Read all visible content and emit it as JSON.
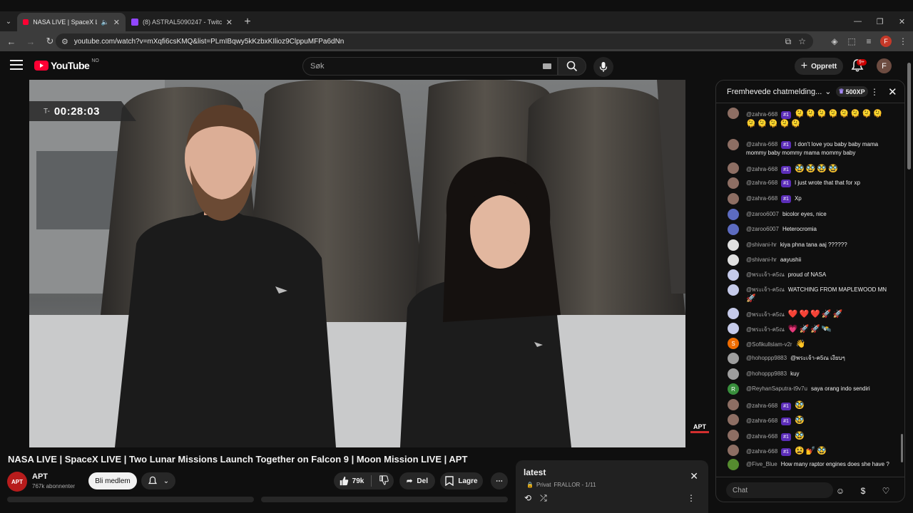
{
  "browser": {
    "tabs": [
      {
        "title": "NASA LIVE | SpaceX LIVE | T",
        "active": true
      },
      {
        "title": "(8) ASTRAL5090247 - Twitch",
        "active": false
      }
    ],
    "url": "youtube.com/watch?v=mXqfi6csKMQ&list=PLmIBqwy5kKzbxKIlioz9ClppuMFPa6dNn",
    "profile_initial": "F"
  },
  "header": {
    "logo_text": "YouTube",
    "country_code": "NO",
    "search_placeholder": "Søk",
    "create_label": "Opprett",
    "notification_count": "9+",
    "avatar_initial": "F"
  },
  "video": {
    "timer_prefix": "T-",
    "timer_value": "00:28:03",
    "watermark": "APT",
    "title": "NASA LIVE | SpaceX LIVE | Two Lunar Missions Launch Together on Falcon 9 | Moon Mission LIVE | APT"
  },
  "channel": {
    "avatar_text": "APT",
    "name": "APT",
    "subscribers": "767k abonnenter",
    "join_label": "Bli medlem"
  },
  "actions": {
    "likes": "79k",
    "share_label": "Del",
    "save_label": "Lagre"
  },
  "playlist": {
    "title": "latest",
    "privacy": "Privat",
    "owner_progress": "FRALLOR - 1/11"
  },
  "chat": {
    "title": "Fremhevede chatmelding...",
    "xp": "500XP",
    "input_placeholder": "Chat",
    "messages": [
      {
        "author": "@zahra-668",
        "badge": "#1",
        "text": "",
        "emoji": "🫠🫠🫠🫠🫠🫠🫠🫠🫠🫠🫠🫠🫠",
        "avatar_color": "#8d6e63",
        "avatar_text": ""
      },
      {
        "author": "@zahra-668",
        "badge": "#1",
        "text": "I don't love you baby baby mama mommy baby mommy mama mommy baby",
        "emoji": "",
        "avatar_color": "#8d6e63",
        "avatar_text": ""
      },
      {
        "author": "@zahra-668",
        "badge": "#1",
        "text": "",
        "emoji": "🥸🥸🥸🥸",
        "avatar_color": "#8d6e63",
        "avatar_text": ""
      },
      {
        "author": "@zahra-668",
        "badge": "#1",
        "text": "I just wrote that that for xp",
        "emoji": "",
        "avatar_color": "#8d6e63",
        "avatar_text": ""
      },
      {
        "author": "@zahra-668",
        "badge": "#1",
        "text": "Xp",
        "emoji": "",
        "avatar_color": "#8d6e63",
        "avatar_text": ""
      },
      {
        "author": "@zaroo6007",
        "badge": "",
        "text": "bicolor eyes, nice",
        "emoji": "",
        "avatar_color": "#5c6bc0",
        "avatar_text": ""
      },
      {
        "author": "@zaroo6007",
        "badge": "",
        "text": "Heterocromia",
        "emoji": "",
        "avatar_color": "#5c6bc0",
        "avatar_text": ""
      },
      {
        "author": "@shivani-hr",
        "badge": "",
        "text": "kiya phna tana aaj ??????",
        "emoji": "",
        "avatar_color": "#e0e0e0",
        "avatar_text": ""
      },
      {
        "author": "@shivani-hr",
        "badge": "",
        "text": "aayushii",
        "emoji": "",
        "avatar_color": "#e0e0e0",
        "avatar_text": ""
      },
      {
        "author": "@พระเจ้า-ค5ณ",
        "badge": "",
        "text": "proud of NASA",
        "emoji": "",
        "avatar_color": "#c5cae9",
        "avatar_text": ""
      },
      {
        "author": "@พระเจ้า-ค5ณ",
        "badge": "",
        "text": "WATCHING FROM MAPLEWOOD MN",
        "emoji": "🚀",
        "avatar_color": "#c5cae9",
        "avatar_text": ""
      },
      {
        "author": "@พระเจ้า-ค5ณ",
        "badge": "",
        "text": "",
        "emoji": "❤️❤️❤️🚀🚀",
        "avatar_color": "#c5cae9",
        "avatar_text": ""
      },
      {
        "author": "@พระเจ้า-ค5ณ",
        "badge": "",
        "text": "",
        "emoji": "💗🚀🚀🛰️",
        "avatar_color": "#c5cae9",
        "avatar_text": ""
      },
      {
        "author": "@Sofikullslam-v2r",
        "badge": "",
        "text": "",
        "emoji": "👋",
        "avatar_color": "#ef6c00",
        "avatar_text": "S"
      },
      {
        "author": "@hohoppp9883",
        "badge": "",
        "text": "@พระเจ้า-ค5ณ เงียบๆ",
        "emoji": "",
        "avatar_color": "#9e9e9e",
        "avatar_text": ""
      },
      {
        "author": "@hohoppp9883",
        "badge": "",
        "text": "kuy",
        "emoji": "",
        "avatar_color": "#9e9e9e",
        "avatar_text": ""
      },
      {
        "author": "@ReyhanSaputra-t9v7u",
        "badge": "",
        "text": "saya orang indo sendiri",
        "emoji": "",
        "avatar_color": "#388e3c",
        "avatar_text": "R"
      },
      {
        "author": "@zahra-668",
        "badge": "#1",
        "text": "",
        "emoji": "🥸",
        "avatar_color": "#8d6e63",
        "avatar_text": ""
      },
      {
        "author": "@zahra-668",
        "badge": "#1",
        "text": "",
        "emoji": "🥸",
        "avatar_color": "#8d6e63",
        "avatar_text": ""
      },
      {
        "author": "@zahra-668",
        "badge": "#1",
        "text": "",
        "emoji": "🥸",
        "avatar_color": "#8d6e63",
        "avatar_text": ""
      },
      {
        "author": "@zahra-668",
        "badge": "#1",
        "text": "",
        "emoji": "😫💅🥸",
        "avatar_color": "#8d6e63",
        "avatar_text": ""
      },
      {
        "author": "@Five_Blue",
        "badge": "",
        "text": "How many raptor engines does she have ?",
        "emoji": "",
        "avatar_color": "#558b2f",
        "avatar_text": ""
      }
    ]
  },
  "colors": {
    "background": "#0f0f0f",
    "accent_red": "#ff0033",
    "member_badge": "#5b2db8"
  }
}
